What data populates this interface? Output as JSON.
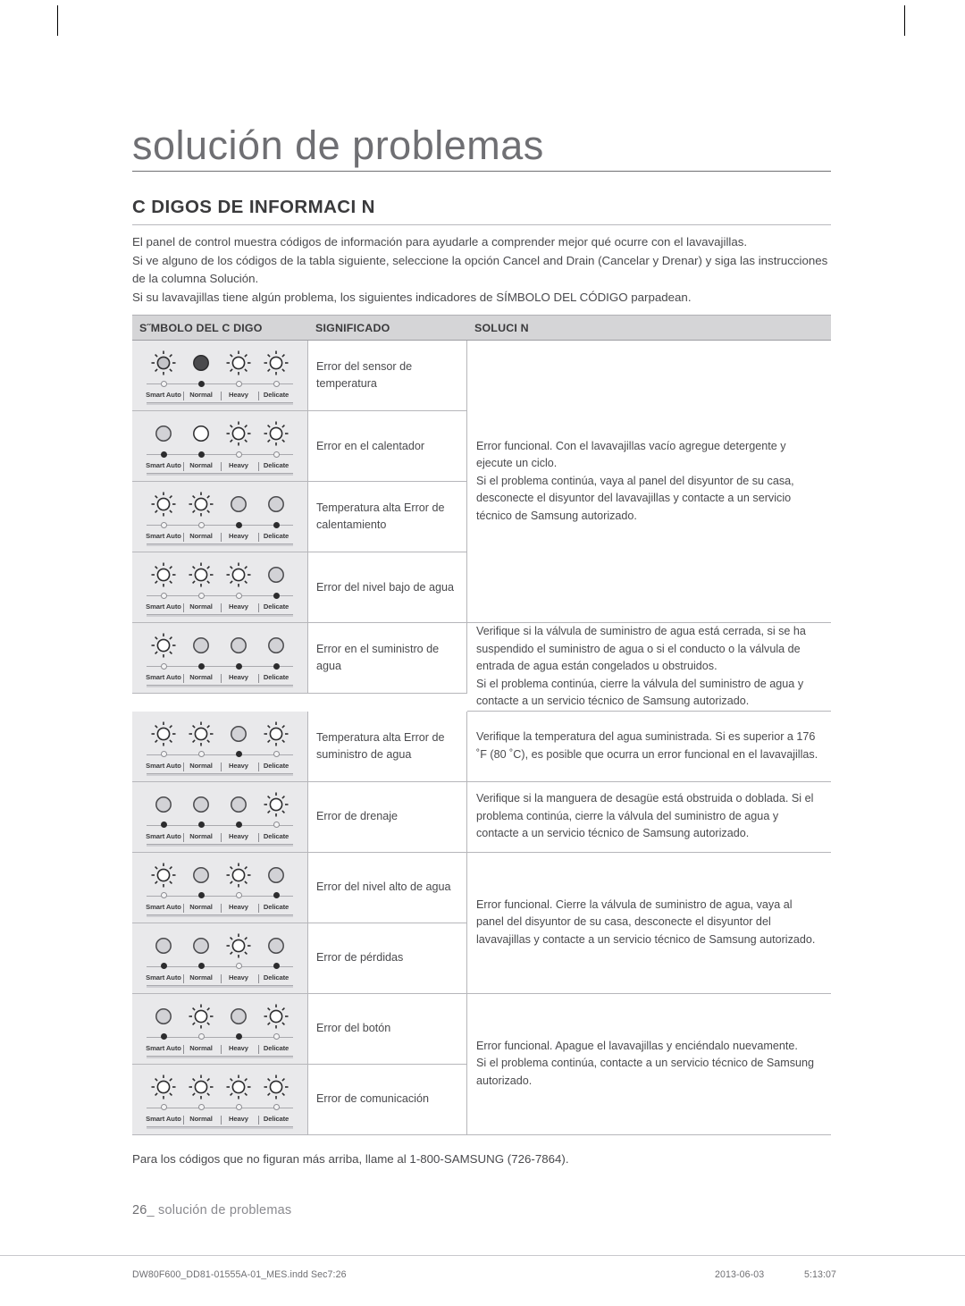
{
  "document": {
    "chapter_title": "solución de problemas",
    "section_heading": "C DIGOS DE INFORMACI N",
    "intro": [
      "El panel de control muestra códigos de información para ayudarle a comprender mejor qué ocurre con el lavavajillas.",
      "Si ve alguno de los códigos de la tabla siguiente, seleccione la opción Cancel and Drain (Cancelar y Drenar) y siga las instrucciones de la columna Solución.",
      "Si su lavavajillas tiene algún problema, los siguientes indicadores de SÍMBOLO DEL CÓDIGO parpadean."
    ],
    "footnote": "Para los códigos que no figuran más arriba, llame al 1-800-SAMSUNG (726-7864).",
    "page_number": "26",
    "page_footer_label": "solución de problemas"
  },
  "table": {
    "headers": {
      "symbol": "S˝MBOLO DEL C DIGO",
      "meaning": "SIGNIFICADO",
      "solution": "SOLUCI N"
    },
    "led_labels": [
      "Smart Auto",
      "Normal",
      "Heavy",
      "Delicate"
    ],
    "rows": [
      {
        "leds": [
          "sun-gray",
          "circle-dark",
          "sun",
          "sun"
        ],
        "dots": [
          "hollow",
          "filled",
          "hollow",
          "hollow"
        ],
        "meaning": "Error del sensor de temperatura"
      },
      {
        "leds": [
          "circle-gray",
          "circle-white",
          "sun",
          "sun"
        ],
        "dots": [
          "filled",
          "filled",
          "hollow",
          "hollow"
        ],
        "meaning": "Error en el calentador"
      },
      {
        "leds": [
          "sun",
          "sun",
          "circle-gray",
          "circle-gray"
        ],
        "dots": [
          "hollow",
          "hollow",
          "filled",
          "filled"
        ],
        "meaning": "Temperatura alta Error de calentamiento"
      },
      {
        "leds": [
          "sun",
          "sun",
          "sun",
          "circle-gray"
        ],
        "dots": [
          "hollow",
          "hollow",
          "hollow",
          "filled"
        ],
        "meaning": "Error del nivel bajo de agua"
      },
      {
        "leds": [
          "sun",
          "circle-gray",
          "circle-gray",
          "circle-gray"
        ],
        "dots": [
          "hollow",
          "filled",
          "filled",
          "filled"
        ],
        "meaning": "Error en el suministro de agua"
      },
      {
        "leds": [
          "sun",
          "sun",
          "circle-gray",
          "sun"
        ],
        "dots": [
          "hollow",
          "hollow",
          "filled",
          "hollow"
        ],
        "meaning": "Temperatura alta Error de suministro de agua"
      },
      {
        "leds": [
          "circle-gray",
          "circle-gray",
          "circle-gray",
          "sun"
        ],
        "dots": [
          "filled",
          "filled",
          "filled",
          "hollow"
        ],
        "meaning": "Error de drenaje"
      },
      {
        "leds": [
          "sun",
          "circle-gray",
          "sun",
          "circle-gray"
        ],
        "dots": [
          "hollow",
          "filled",
          "hollow",
          "filled"
        ],
        "meaning": "Error del nivel alto de agua"
      },
      {
        "leds": [
          "circle-gray",
          "circle-gray",
          "sun",
          "circle-gray"
        ],
        "dots": [
          "filled",
          "filled",
          "hollow",
          "filled"
        ],
        "meaning": "Error de pérdidas"
      },
      {
        "leds": [
          "circle-gray",
          "sun",
          "circle-gray",
          "sun"
        ],
        "dots": [
          "filled",
          "hollow",
          "filled",
          "hollow"
        ],
        "meaning": "Error del botón"
      },
      {
        "leds": [
          "sun",
          "sun",
          "sun",
          "sun"
        ],
        "dots": [
          "hollow",
          "hollow",
          "hollow",
          "hollow"
        ],
        "meaning": "Error de comunicación"
      }
    ],
    "solutions": [
      {
        "paragraphs": [
          "Error funcional. Con el lavavajillas vacío agregue detergente y ejecute un ciclo.",
          "Si el problema continúa, vaya al panel del disyuntor de su casa, desconecte el disyuntor del lavavajillas y contacte a un servicio técnico de Samsung autorizado."
        ]
      },
      {
        "paragraphs": [
          "Verifique si la válvula de suministro de agua está cerrada, si se ha suspendido el suministro de agua o si el conducto o la válvula de entrada de agua están congelados u obstruidos.",
          "Si el problema continúa, cierre la válvula del suministro de agua y contacte a un servicio técnico de Samsung autorizado."
        ]
      },
      {
        "paragraphs": [
          "Verifique la temperatura del agua suministrada. Si es superior a 176 ˚F (80 ˚C), es posible que ocurra un error funcional en el lavavajillas."
        ]
      },
      {
        "paragraphs": [
          "Verifique si la manguera de desagüe está obstruida o doblada. Si el problema continúa, cierre la válvula del suministro de agua y contacte a un servicio técnico de Samsung autorizado."
        ]
      },
      {
        "paragraphs": [
          "Error funcional. Cierre la válvula de suministro de agua, vaya al panel del disyuntor de su casa, desconecte el disyuntor del lavavajillas y contacte a un servicio técnico de Samsung autorizado."
        ]
      },
      {
        "paragraphs": [
          "Error funcional. Apague el lavavajillas y enciéndalo nuevamente.",
          "Si el problema continúa, contacte a un servicio técnico de Samsung autorizado."
        ]
      }
    ]
  },
  "imprint": {
    "file": "DW80F600_DD81-01555A-01_MES.indd   Sec7:26",
    "date": "2013-06-03",
    "time": "5:13:07"
  }
}
